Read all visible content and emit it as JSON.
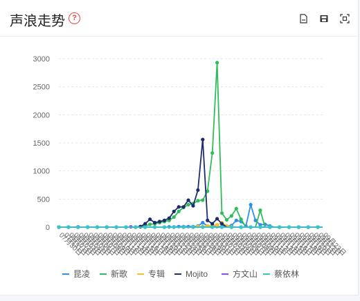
{
  "header": {
    "title": "声浪走势",
    "help_glyph": "?",
    "tools": [
      "download-image-icon",
      "save-icon",
      "fullscreen-icon"
    ]
  },
  "chart_data": {
    "type": "line",
    "title": "",
    "xlabel": "",
    "ylabel": "",
    "ylim": [
      0,
      3000
    ],
    "yticks": [
      0,
      500,
      1000,
      1500,
      2000,
      2500,
      3000
    ],
    "grid": true,
    "legend_position": "bottom",
    "x": [
      "07月30日",
      "07月31日",
      "08月01日",
      "08月02日",
      "08月03日",
      "08月04日",
      "08月05日",
      "08月06日",
      "08月07日",
      "08月08日",
      "08月09日",
      "08月10日",
      "08月11日",
      "08月12日",
      "08月13日",
      "08月14日",
      "08月15日",
      "08月16日",
      "08月17日",
      "08月18日",
      "08月19日",
      "08月20日",
      "08月21日",
      "08月22日",
      "08月23日",
      "08月24日",
      "08月25日",
      "08月26日",
      "08月27日",
      "08月28日",
      "08月29日",
      "08月30日",
      "08月31日",
      "09月01日",
      "09月02日",
      "09月03日",
      "09月04日",
      "09月05日",
      "09月06日",
      "09月07日",
      "09月08日",
      "09月09日",
      "09月10日",
      "09月11日",
      "09月12日",
      "09月13日",
      "09月14日",
      "09月15日",
      "09月16日",
      "09月17日",
      "09月18日",
      "09月19日",
      "09月20日",
      "09月21日",
      "09月22日",
      "09月23日"
    ],
    "series": [
      {
        "name": "昆凌",
        "color": "#2f8fe8",
        "values": [
          0,
          0,
          0,
          0,
          0,
          0,
          0,
          0,
          0,
          0,
          0,
          0,
          0,
          0,
          0,
          0,
          0,
          0,
          0,
          0,
          0,
          0,
          0,
          5,
          5,
          10,
          10,
          10,
          10,
          20,
          80,
          20,
          10,
          10,
          10,
          20,
          30,
          120,
          100,
          20,
          400,
          120,
          40,
          50,
          20,
          0,
          0,
          0,
          0,
          0,
          0,
          0,
          0,
          0,
          0,
          0
        ]
      },
      {
        "name": "新歌",
        "color": "#2ebd5a",
        "values": [
          0,
          0,
          0,
          0,
          0,
          0,
          0,
          0,
          0,
          0,
          0,
          0,
          0,
          0,
          0,
          0,
          0,
          5,
          20,
          50,
          60,
          80,
          100,
          120,
          180,
          280,
          350,
          400,
          420,
          470,
          480,
          640,
          1320,
          2930,
          250,
          130,
          200,
          330,
          140,
          0,
          0,
          0,
          300,
          0,
          0,
          0,
          0,
          0,
          0,
          0,
          0,
          0,
          0,
          0,
          0,
          0
        ]
      },
      {
        "name": "专辑",
        "color": "#f5c02e",
        "values": [
          0,
          0,
          0,
          0,
          0,
          0,
          0,
          0,
          0,
          0,
          0,
          0,
          0,
          0,
          0,
          0,
          0,
          0,
          0,
          0,
          0,
          0,
          0,
          0,
          0,
          0,
          0,
          0,
          0,
          10,
          10,
          20,
          30,
          40,
          80,
          20,
          10,
          0,
          0,
          0,
          0,
          0,
          0,
          0,
          0,
          0,
          0,
          0,
          0,
          0,
          0,
          0,
          0,
          0,
          0,
          0
        ]
      },
      {
        "name": "Mojito",
        "color": "#1d2c6b",
        "values": [
          0,
          0,
          0,
          0,
          0,
          0,
          0,
          0,
          0,
          0,
          0,
          0,
          0,
          0,
          0,
          0,
          0,
          10,
          60,
          140,
          80,
          100,
          120,
          160,
          280,
          360,
          360,
          480,
          380,
          660,
          1560,
          120,
          60,
          150,
          60,
          0,
          0,
          0,
          0,
          0,
          0,
          0,
          0,
          0,
          0,
          0,
          0,
          0,
          0,
          0,
          0,
          0,
          0,
          0,
          0,
          0
        ]
      },
      {
        "name": "方文山",
        "color": "#8a4de0",
        "values": [
          0,
          0,
          0,
          0,
          5,
          0,
          0,
          0,
          0,
          0,
          0,
          0,
          0,
          0,
          0,
          5,
          0,
          0,
          0,
          0,
          0,
          0,
          0,
          0,
          0,
          0,
          0,
          0,
          0,
          0,
          0,
          0,
          0,
          0,
          0,
          0,
          0,
          0,
          0,
          0,
          0,
          0,
          0,
          0,
          0,
          0,
          0,
          0,
          0,
          0,
          0,
          0,
          0,
          0,
          0,
          0
        ]
      },
      {
        "name": "蔡依林",
        "color": "#33c9c9",
        "values": [
          0,
          0,
          0,
          0,
          0,
          0,
          0,
          0,
          0,
          0,
          0,
          0,
          0,
          0,
          0,
          0,
          0,
          0,
          0,
          0,
          0,
          0,
          0,
          0,
          0,
          0,
          0,
          0,
          0,
          0,
          0,
          0,
          0,
          0,
          0,
          0,
          0,
          0,
          0,
          0,
          0,
          0,
          0,
          0,
          0,
          0,
          0,
          0,
          0,
          0,
          0,
          0,
          0,
          0,
          0,
          0
        ]
      }
    ]
  }
}
